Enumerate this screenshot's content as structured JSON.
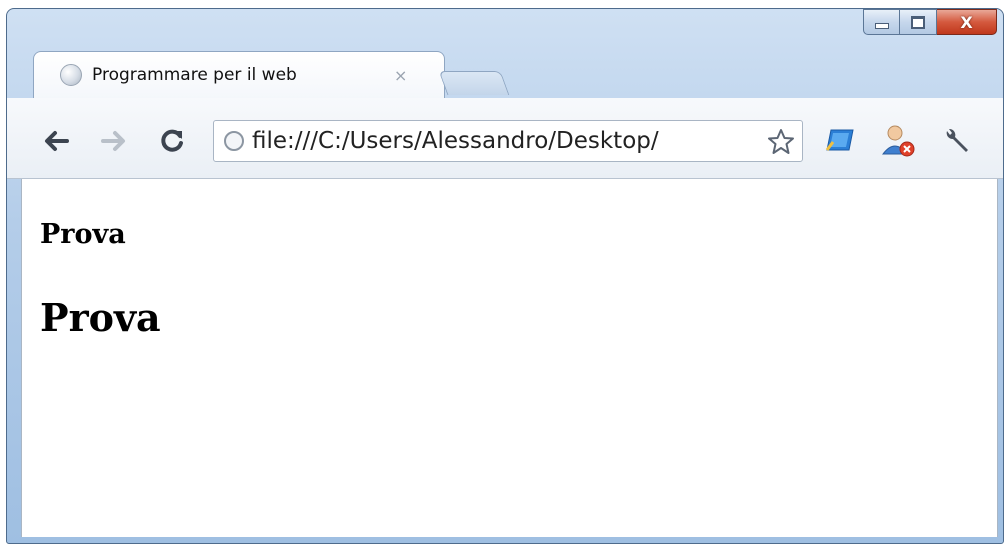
{
  "window": {
    "controls": {
      "close_glyph": "X"
    }
  },
  "tab": {
    "title": "Programmare per il web",
    "close_glyph": "×",
    "icon": "globe-icon"
  },
  "toolbar": {
    "url": "file:///C:/Users/Alessandro/Desktop/",
    "icons": [
      "back-arrow-icon",
      "forward-arrow-icon",
      "reload-icon",
      "star-icon",
      "extension-icon",
      "user-icon",
      "wrench-icon"
    ]
  },
  "page": {
    "heading_small": "Prova",
    "heading_large": "Prova"
  },
  "colors": {
    "titlebar": "#b4cde9",
    "close_button": "#c0381c"
  }
}
